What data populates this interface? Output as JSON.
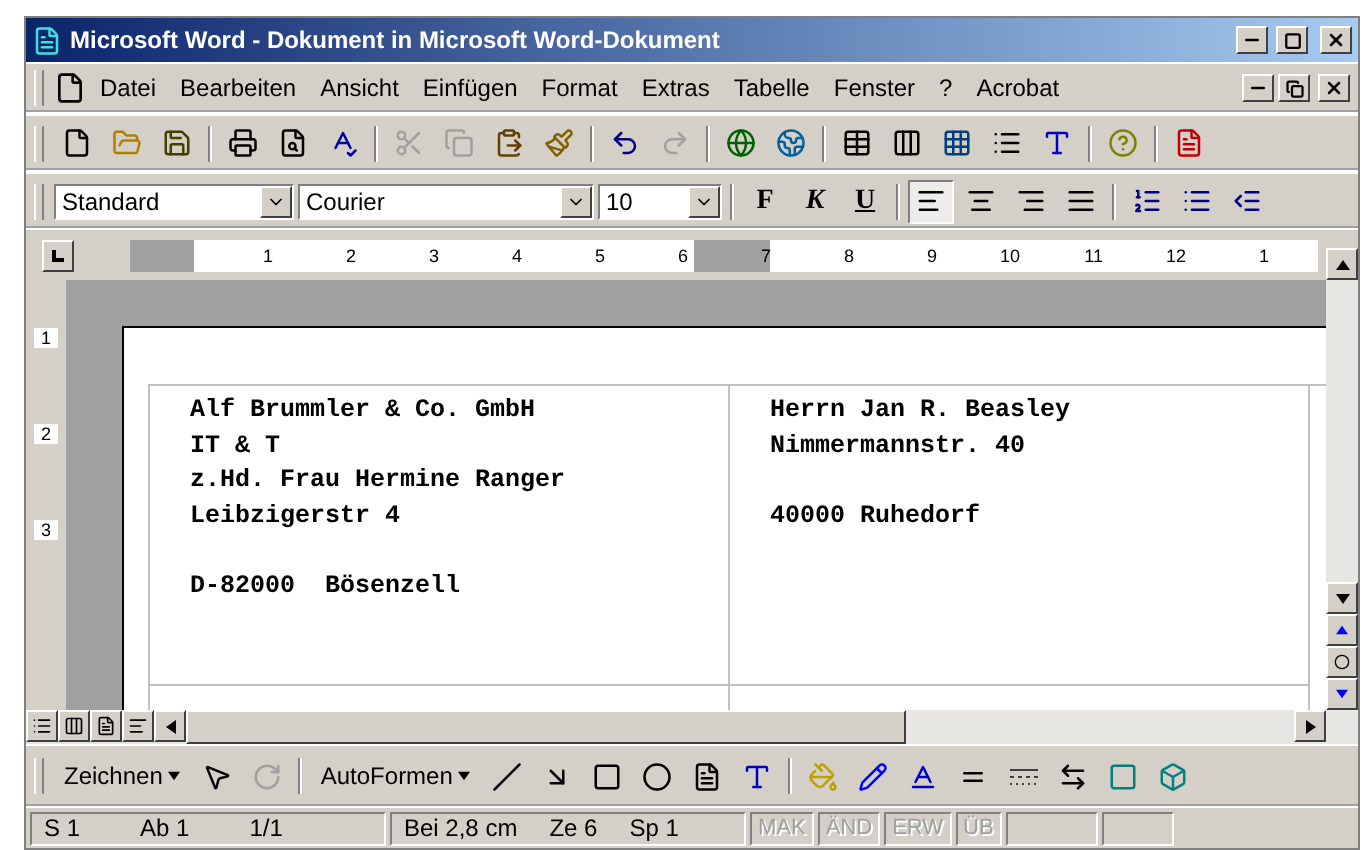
{
  "window": {
    "title": "Microsoft Word - Dokument in Microsoft Word-Dokument"
  },
  "menu": [
    "Datei",
    "Bearbeiten",
    "Ansicht",
    "Einfügen",
    "Format",
    "Extras",
    "Tabelle",
    "Fenster",
    "?",
    "Acrobat"
  ],
  "format_toolbar": {
    "style": "Standard",
    "font": "Courier",
    "size": "10",
    "char_buttons": [
      {
        "label": "F",
        "kind": "bold",
        "selected": false
      },
      {
        "label": "K",
        "kind": "italic",
        "selected": false
      },
      {
        "label": "U",
        "kind": "underline",
        "selected": false
      }
    ],
    "alignments": [
      {
        "kind": "left",
        "selected": true
      },
      {
        "kind": "center",
        "selected": false
      },
      {
        "kind": "right",
        "selected": false
      },
      {
        "kind": "justify",
        "selected": false
      }
    ]
  },
  "ruler": {
    "labels": [
      "1",
      "2",
      "3",
      "4",
      "5",
      "6",
      "7",
      "8",
      "9",
      "10",
      "11",
      "12",
      "1"
    ]
  },
  "vertical_ruler": {
    "labels": [
      "1",
      "2",
      "3"
    ]
  },
  "document": {
    "columns": [
      {
        "blocks": [
          [
            "Alf Brummler & Co. GmbH",
            "IT & T",
            "z.Hd. Frau Hermine Ranger",
            "Leibzigerstr 4"
          ],
          [
            "D-82000  Bösenzell"
          ]
        ]
      },
      {
        "blocks": [
          [
            "Herrn Jan R. Beasley",
            "Nimmermannstr. 40"
          ],
          [
            "40000 Ruhedorf"
          ]
        ]
      }
    ]
  },
  "drawing_toolbar": {
    "draw_menu": "Zeichnen",
    "autoshapes_menu": "AutoFormen"
  },
  "status_bar": {
    "fields": [
      "S 1",
      "Ab 1",
      "1/1"
    ],
    "position": [
      "Bei 2,8 cm",
      "Ze 6",
      "Sp 1"
    ],
    "modes": [
      {
        "label": "MAK",
        "disabled": true
      },
      {
        "label": "ÄND",
        "disabled": true
      },
      {
        "label": "ERW",
        "disabled": true
      },
      {
        "label": "ÜB",
        "disabled": true
      }
    ]
  }
}
